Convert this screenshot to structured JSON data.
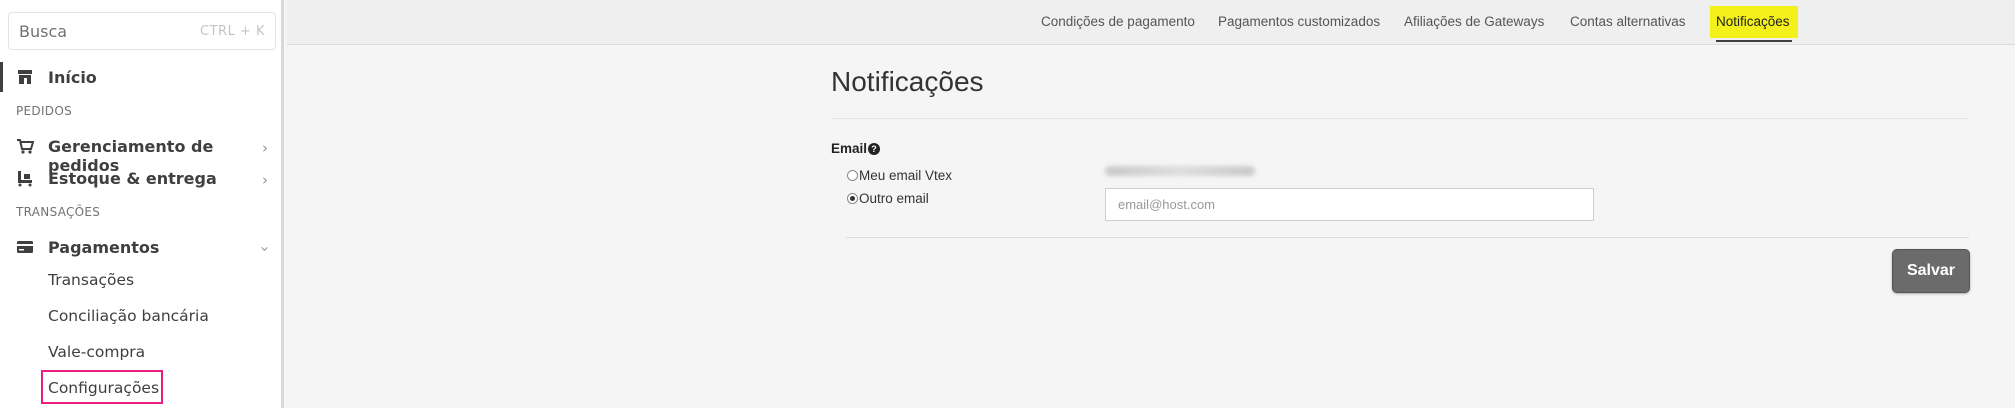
{
  "sidebar": {
    "search": {
      "placeholder": "Busca",
      "shortcut": "CTRL + K"
    },
    "home": {
      "label": "Início",
      "icon": "store-icon"
    },
    "sections": [
      {
        "label": "PEDIDOS"
      },
      {
        "label": "TRANSAÇÕES"
      }
    ],
    "items": [
      {
        "label": "Gerenciamento de pedidos",
        "icon": "cart-icon"
      },
      {
        "label": "Estoque & entrega",
        "icon": "forklift-icon"
      },
      {
        "label": "Pagamentos",
        "icon": "credit-card-icon"
      }
    ],
    "payments_sub": [
      "Transações",
      "Conciliação bancária",
      "Vale-compra",
      "Configurações"
    ]
  },
  "tabs": [
    "Condições de pagamento",
    "Pagamentos customizados",
    "Afiliações de Gateways",
    "Contas alternativas",
    "Notificações"
  ],
  "main": {
    "title": "Notificações",
    "email_label": "Email",
    "help_icon": "question-circle-icon",
    "options": [
      {
        "label": "Meu email Vtex",
        "checked": false
      },
      {
        "label": "Outro email",
        "checked": true
      }
    ],
    "email_placeholder": "email@host.com",
    "save_label": "Salvar"
  },
  "colors": {
    "active_tab_bg": "#f3f01a",
    "highlight_border": "#e91e82",
    "save_button": "#6b6b6b"
  }
}
